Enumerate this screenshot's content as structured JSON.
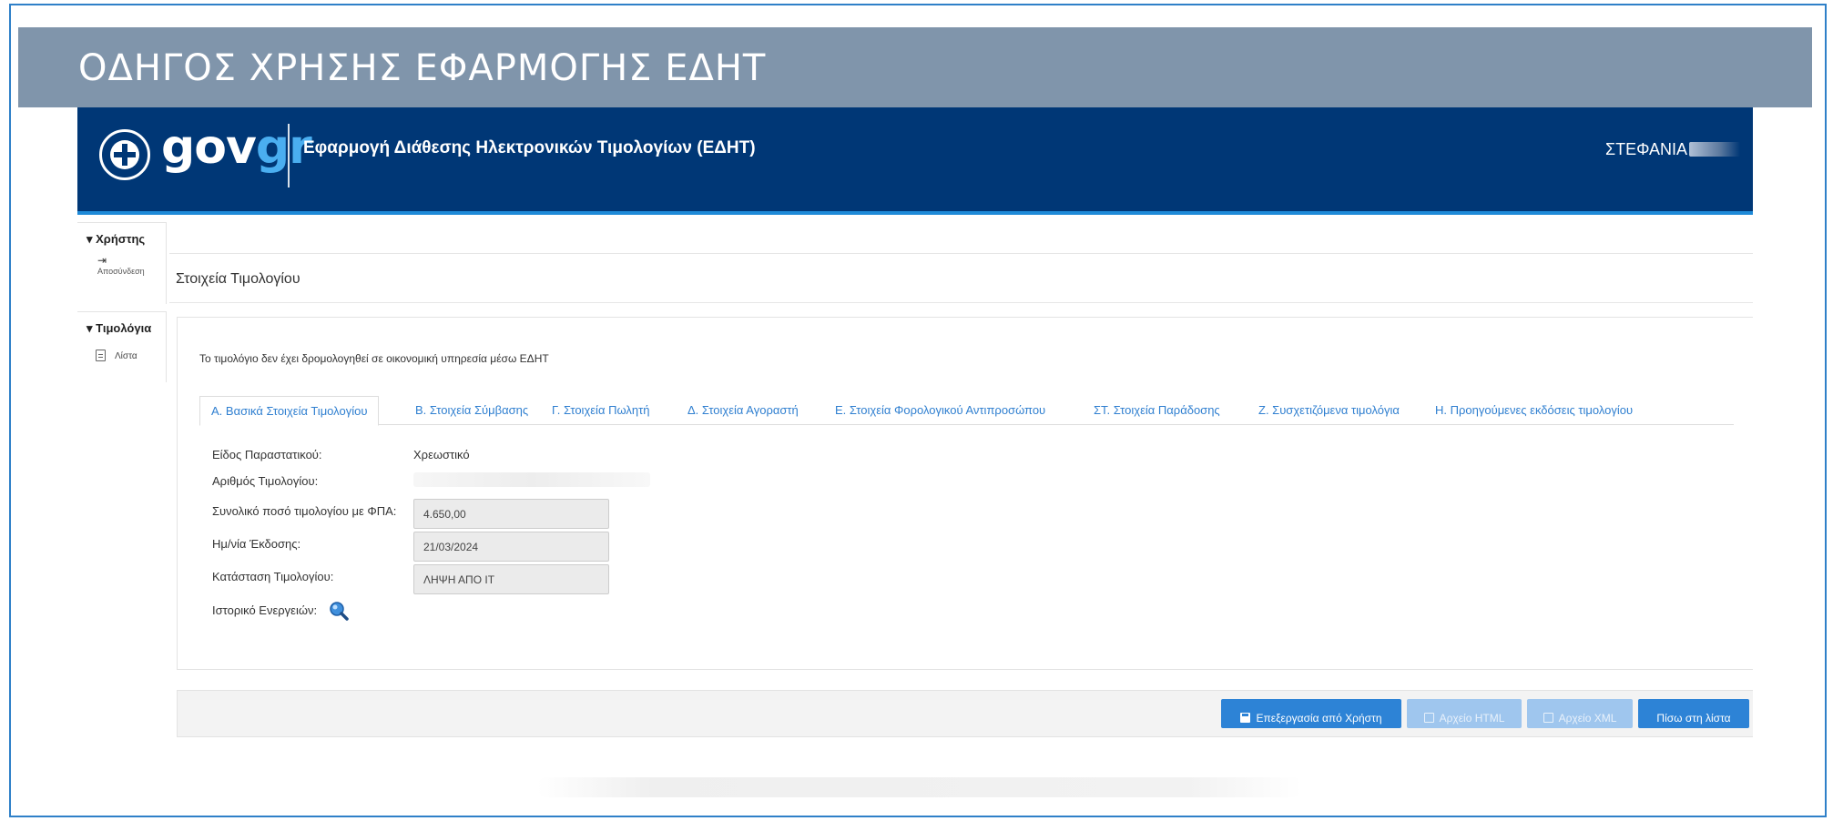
{
  "banner": {
    "title": "ΟΔΗΓΟΣ ΧΡΗΣΗΣ ΕΦΑΡΜΟΓΗΣ ΕΔΗΤ"
  },
  "header": {
    "logo_gov": "gov",
    "logo_gr": "gr",
    "app_title": "Εφαρμογή Διάθεσης Ηλεκτρονικών Τιμολογίων (ΕΔΗΤ)",
    "user_name": "ΣΤΕΦΑΝΙΑ"
  },
  "sidebar": {
    "user_section": "Χρήστης",
    "logout_label": "Αποσύνδεση",
    "invoices_section": "Τιμολόγια",
    "list_label": "Λίστα"
  },
  "main": {
    "section_title": "Στοιχεία Τιμολογίου",
    "notice": "Το τιμολόγιο δεν έχει δρομολογηθεί σε οικονομική υπηρεσία μέσω ΕΔΗΤ",
    "tabs": [
      {
        "label": "Α. Βασικά Στοιχεία Τιμολογίου"
      },
      {
        "label": "Β. Στοιχεία Σύμβασης"
      },
      {
        "label": "Γ. Στοιχεία Πωλητή"
      },
      {
        "label": "Δ. Στοιχεία Αγοραστή"
      },
      {
        "label": "Ε. Στοιχεία Φορολογικού Αντιπροσώπου"
      },
      {
        "label": "ΣΤ. Στοιχεία Παράδοσης"
      },
      {
        "label": "Ζ. Συσχετιζόμενα τιμολόγια"
      },
      {
        "label": "Η. Προηγούμενες εκδόσεις τιμολογίου"
      }
    ],
    "fields": {
      "doc_type_label": "Είδος Παραστατικού:",
      "doc_type_value": "Χρεωστικό",
      "invoice_number_label": "Αριθμός Τιμολογίου:",
      "total_amount_label": "Συνολικό ποσό τιμολογίου με ΦΠΑ:",
      "total_amount_value": "4.650,00",
      "issue_date_label": "Ημ/νία Έκδοσης:",
      "issue_date_value": "21/03/2024",
      "status_label": "Κατάσταση Τιμολογίου:",
      "status_value": "ΛΗΨΗ ΑΠΟ ΙΤ",
      "history_label": "Ιστορικό Ενεργειών:"
    }
  },
  "footer": {
    "edit_button": "Επεξεργασία από Χρήστη",
    "html_button": "Αρχείο HTML",
    "xml_button": "Αρχείο XML",
    "back_button": "Πίσω στη λίστα"
  },
  "colors": {
    "banner": "#8095ab",
    "header": "#003776",
    "accent": "#2d83d6",
    "link": "#2f7fd0"
  },
  "icons": [
    "greek-emblem-icon",
    "logout-icon",
    "document-icon",
    "search-icon",
    "save-icon",
    "file-icon"
  ]
}
